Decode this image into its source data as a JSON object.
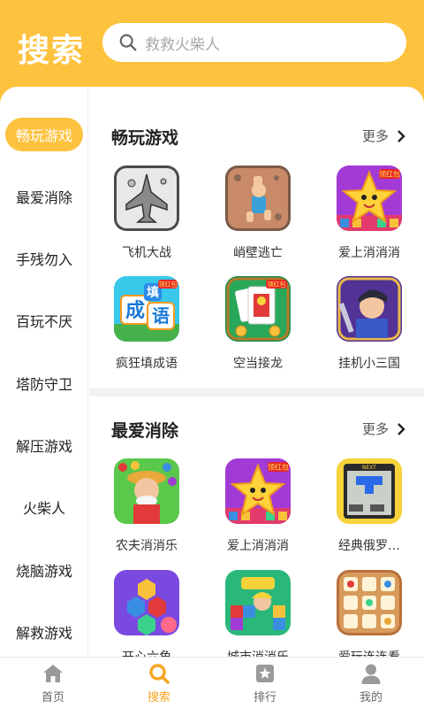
{
  "header": {
    "title": "搜索",
    "search_placeholder": "救救火柴人"
  },
  "sidebar": {
    "items": [
      {
        "label": "畅玩游戏",
        "active": true
      },
      {
        "label": "最爱消除"
      },
      {
        "label": "手残勿入"
      },
      {
        "label": "百玩不厌"
      },
      {
        "label": "塔防守卫"
      },
      {
        "label": "解压游戏"
      },
      {
        "label": "火柴人"
      },
      {
        "label": "烧脑游戏"
      },
      {
        "label": "解救游戏"
      }
    ]
  },
  "sections": [
    {
      "title": "畅玩游戏",
      "more_label": "更多",
      "games": [
        "飞机大战",
        "峭壁逃亡",
        "爱上消消消",
        "疯狂填成语",
        "空当接龙",
        "挂机小三国"
      ]
    },
    {
      "title": "最爱消除",
      "more_label": "更多",
      "games": [
        "农夫消消乐",
        "爱上消消消",
        "经典俄罗…",
        "开心六角",
        "城市消消乐",
        "爱玩连连看"
      ]
    }
  ],
  "badges": {
    "red_packet": "领红包",
    "idiom_chars": [
      "成",
      "语",
      "填"
    ],
    "next": "NEXT"
  },
  "bottom_nav": [
    {
      "label": "首页",
      "icon": "home-icon"
    },
    {
      "label": "搜索",
      "icon": "search-icon",
      "active": true
    },
    {
      "label": "排行",
      "icon": "ranking-icon"
    },
    {
      "label": "我的",
      "icon": "profile-icon"
    }
  ],
  "colors": {
    "accent": "#FDC23E",
    "active_nav": "#F5A623"
  }
}
